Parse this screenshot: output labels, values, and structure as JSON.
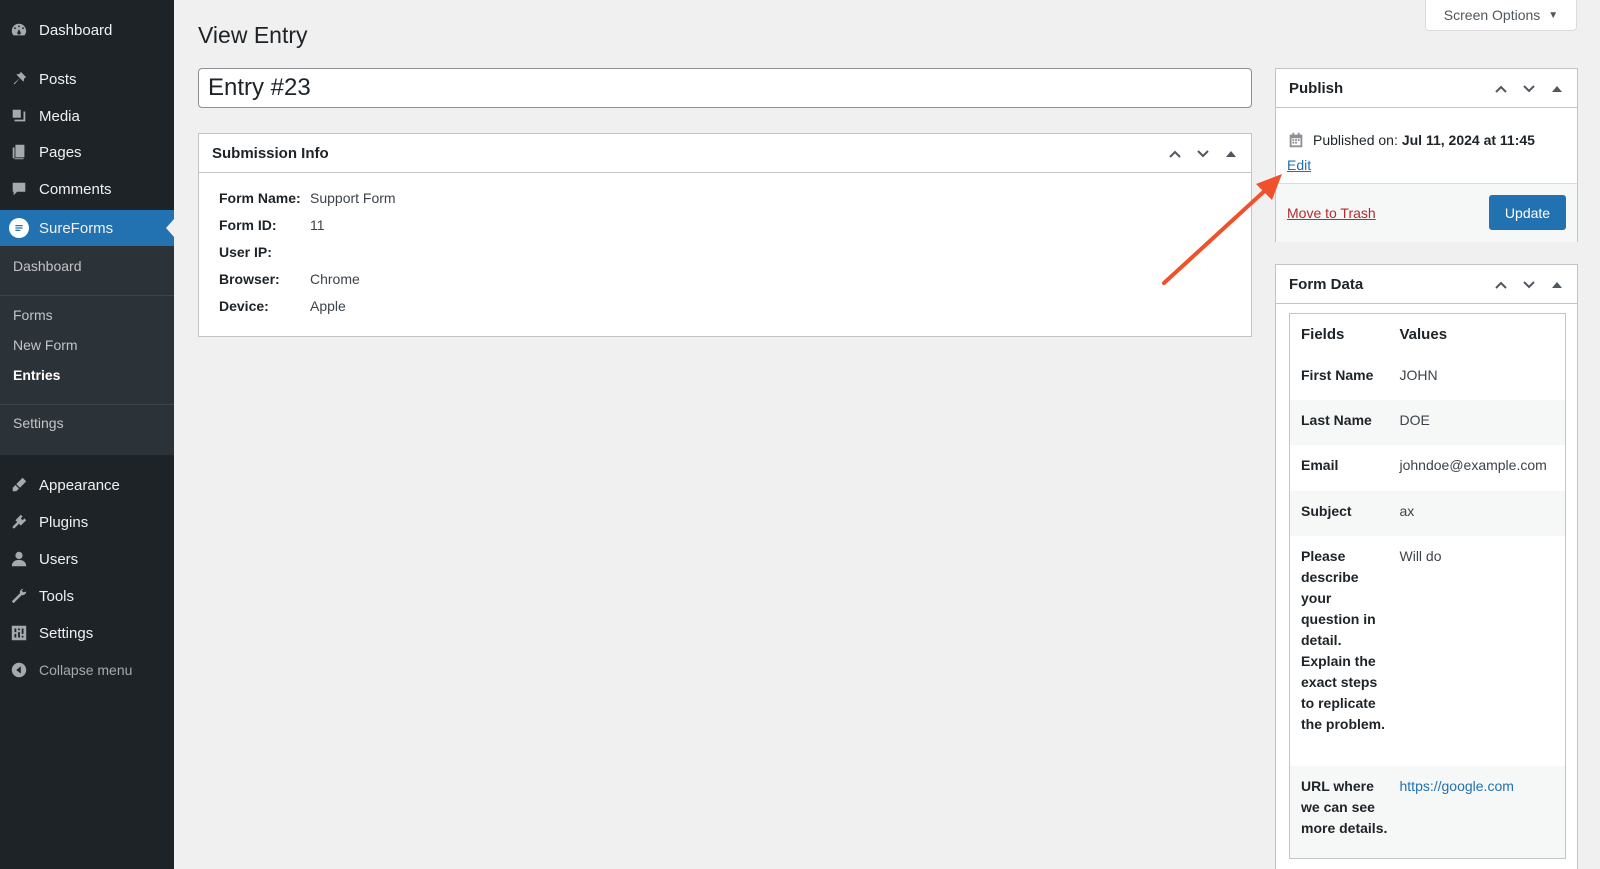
{
  "sidebar": {
    "items": [
      {
        "label": "Dashboard",
        "icon": "dashboard-icon"
      },
      {
        "label": "Posts",
        "icon": "pin-icon"
      },
      {
        "label": "Media",
        "icon": "media-icon"
      },
      {
        "label": "Pages",
        "icon": "pages-icon"
      },
      {
        "label": "Comments",
        "icon": "comment-icon"
      },
      {
        "label": "SureForms",
        "icon": "sureforms-icon"
      },
      {
        "label": "Appearance",
        "icon": "brush-icon"
      },
      {
        "label": "Plugins",
        "icon": "plugin-icon"
      },
      {
        "label": "Users",
        "icon": "user-icon"
      },
      {
        "label": "Tools",
        "icon": "wrench-icon"
      },
      {
        "label": "Settings",
        "icon": "settings-icon"
      }
    ],
    "submenu": [
      "Dashboard",
      "Forms",
      "New Form",
      "Entries",
      "Settings"
    ],
    "collapse_label": "Collapse menu"
  },
  "header": {
    "screen_options": "Screen Options",
    "title": "View Entry"
  },
  "entry_title": "Entry #23",
  "submission_info": {
    "title": "Submission Info",
    "rows": [
      {
        "label": "Form Name:",
        "value": "Support Form"
      },
      {
        "label": "Form ID:",
        "value": "11"
      },
      {
        "label": "User IP:",
        "value": ""
      },
      {
        "label": "Browser:",
        "value": "Chrome"
      },
      {
        "label": "Device:",
        "value": "Apple"
      }
    ]
  },
  "publish": {
    "title": "Publish",
    "published_label": "Published on:",
    "published_date": "Jul 11, 2024 at 11:45",
    "edit_label": "Edit",
    "trash_label": "Move to Trash",
    "update_label": "Update"
  },
  "form_data": {
    "title": "Form Data",
    "headers": [
      "Fields",
      "Values"
    ],
    "rows": [
      {
        "field": "First Name",
        "value": "JOHN"
      },
      {
        "field": "Last Name",
        "value": "DOE"
      },
      {
        "field": "Email",
        "value": "johndoe@example.com"
      },
      {
        "field": "Subject",
        "value": "ax"
      },
      {
        "field": "Please describe your question in detail. Explain the exact steps to replicate the problem.",
        "value": "Will do"
      },
      {
        "field": "URL where we can see more details.",
        "value": "https://google.com"
      }
    ]
  },
  "colors": {
    "sidebar_bg": "#1d2327",
    "accent": "#2271b1",
    "annotation_arrow": "#f0502a",
    "trash_link": "#b32d2e"
  }
}
